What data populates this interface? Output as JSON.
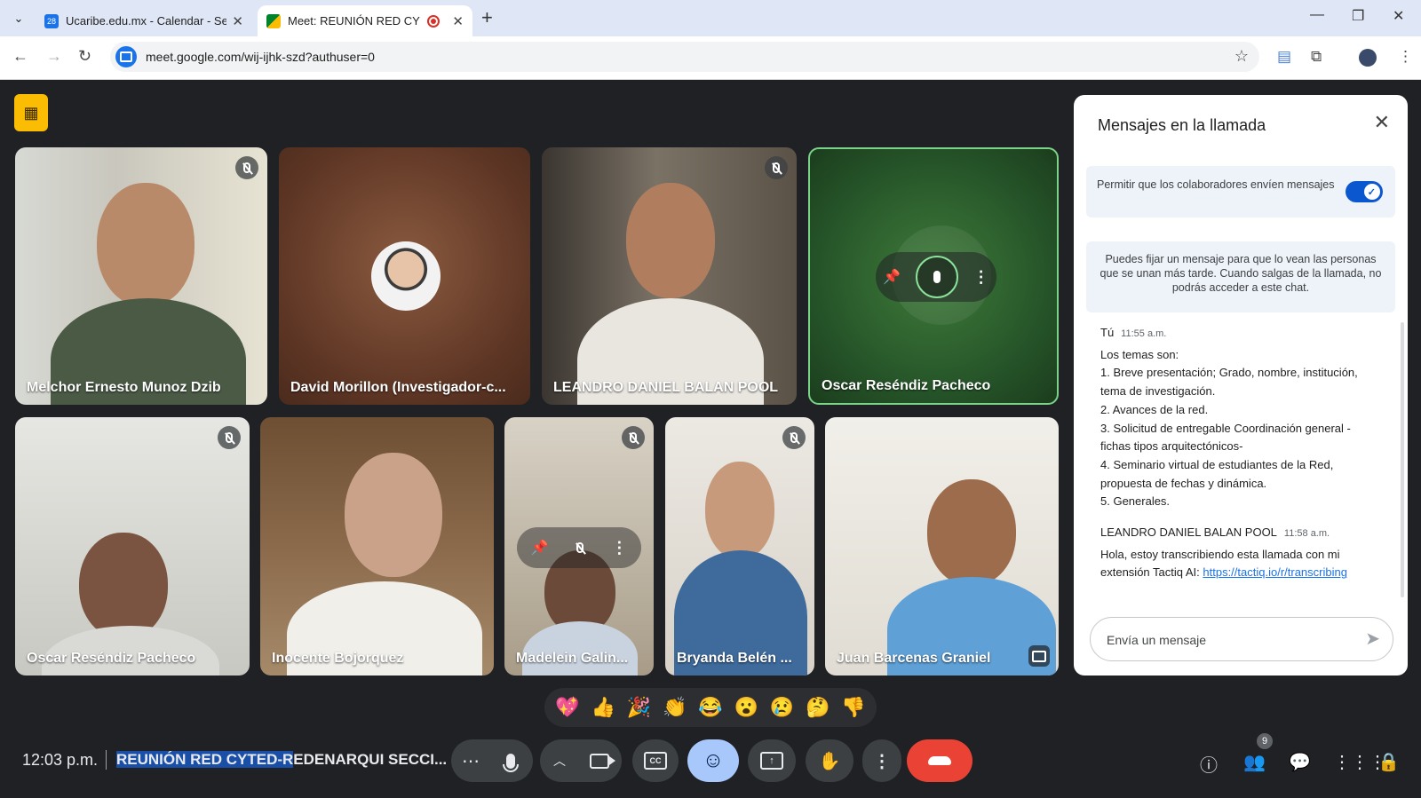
{
  "browser": {
    "tabs": [
      {
        "title": "Ucaribe.edu.mx - Calendar - Semana",
        "favicon_text": "28",
        "favicon_color": "#1a73e8"
      },
      {
        "title": "Meet: REUNIÓN RED CYTED-REDENARQUI",
        "favicon_text": "",
        "favicon_color": "#00832d"
      }
    ],
    "url": "meet.google.com/wij-ijhk-szd?authuser=0"
  },
  "participants": [
    {
      "name": "Melchor Ernesto Munoz Dzib",
      "muted": true
    },
    {
      "name": "David Morillon (Investigador-c...",
      "muted": false
    },
    {
      "name": "LEANDRO DANIEL BALAN POOL",
      "muted": true
    },
    {
      "name": "Oscar Reséndiz Pacheco",
      "muted": false,
      "speaking": true
    },
    {
      "name": "Oscar Reséndiz Pacheco",
      "muted": true
    },
    {
      "name": "Inocente Bojorquez",
      "muted": false
    },
    {
      "name": "Madelein Galin...",
      "muted": true
    },
    {
      "name": "Bryanda Belén ...",
      "muted": true
    },
    {
      "name": "Juan Barcenas Graniel",
      "muted": false
    }
  ],
  "chat": {
    "title": "Mensajes en la llamada",
    "permit_label": "Permitir que los colaboradores envíen mensajes",
    "permit_enabled": true,
    "note": "Puedes fijar un mensaje para que lo vean las personas que se unan más tarde. Cuando salgas de la llamada, no podrás acceder a este chat.",
    "messages": [
      {
        "sender": "Tú",
        "time": "11:55 a.m.",
        "lines": [
          "Los temas son:",
          "1. Breve presentación; Grado, nombre, institución,",
          "tema de investigación.",
          "2. Avances de la red.",
          "3. Solicitud de entregable Coordinación general -",
          "fichas tipos arquitectónicos-",
          "4. Seminario virtual de estudiantes de la Red,",
          "propuesta de fechas y dinámica.",
          "5. Generales."
        ]
      },
      {
        "sender": "LEANDRO DANIEL BALAN POOL",
        "time": "11:58 a.m.",
        "lines": [
          "Hola, estoy transcribiendo esta llamada con mi"
        ],
        "last_line_prefix": "extensión Tactiq AI: ",
        "link": "https://tactiq.io/r/transcribing"
      }
    ],
    "compose_placeholder": "Envía un mensaje"
  },
  "reactions": [
    "💖",
    "👍",
    "🎉",
    "👏",
    "😂",
    "😮",
    "😢",
    "🤔",
    "👎"
  ],
  "bottom": {
    "time": "12:03 p.m.",
    "meeting_title_selected": "REUNIÓN RED CYTED-R",
    "meeting_title_rest": "EDENARQUI SECCI...",
    "people_count": "9"
  },
  "colors": {
    "meet_bg": "#202124",
    "accent": "#0b57d0",
    "hangup": "#ea4335",
    "speaking_border": "#7bd389",
    "host_badge": "#fbbc04"
  }
}
